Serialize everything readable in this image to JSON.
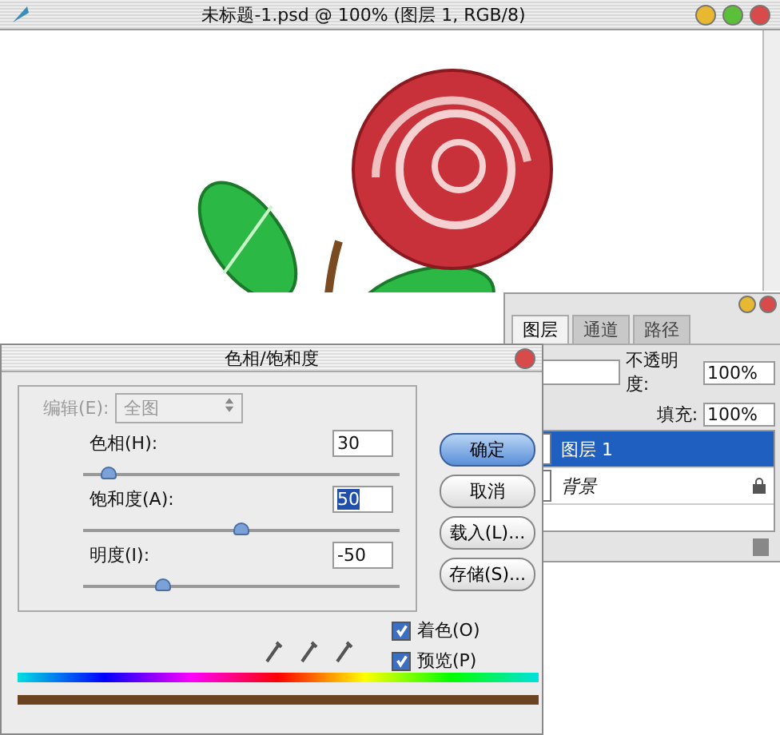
{
  "document_window": {
    "title": "未标题-1.psd @ 100% (图层 1, RGB/8)"
  },
  "layers_panel": {
    "tabs": [
      {
        "label": "图层",
        "selected": true
      },
      {
        "label": "通道",
        "selected": false
      },
      {
        "label": "路径",
        "selected": false
      }
    ],
    "opacity_label": "不透明度:",
    "opacity": "100%",
    "fill_label": "填充:",
    "fill": "100%",
    "layers": [
      {
        "name": "图层 1",
        "selected": true,
        "locked": false
      },
      {
        "name": "背景",
        "selected": false,
        "locked": true
      }
    ]
  },
  "dialog": {
    "title": "色相/饱和度",
    "edit_label": "编辑(E):",
    "edit_value": "全图",
    "edit_disabled": true,
    "sliders": [
      {
        "label": "色相(H):",
        "value": "30",
        "level": 0.08,
        "selected": false
      },
      {
        "label": "饱和度(A):",
        "value": "50",
        "level": 0.5,
        "selected": true
      },
      {
        "label": "明度(I):",
        "value": "-50",
        "level": 0.25,
        "selected": false
      }
    ],
    "buttons": [
      {
        "label": "确定",
        "default": true
      },
      {
        "label": "取消",
        "default": false
      },
      {
        "label": "载入(L)...",
        "default": false
      },
      {
        "label": "存储(S)...",
        "default": false
      }
    ],
    "checkboxes": [
      {
        "label": "着色(O)",
        "checked": true
      },
      {
        "label": "预览(P)",
        "checked": true
      }
    ]
  }
}
